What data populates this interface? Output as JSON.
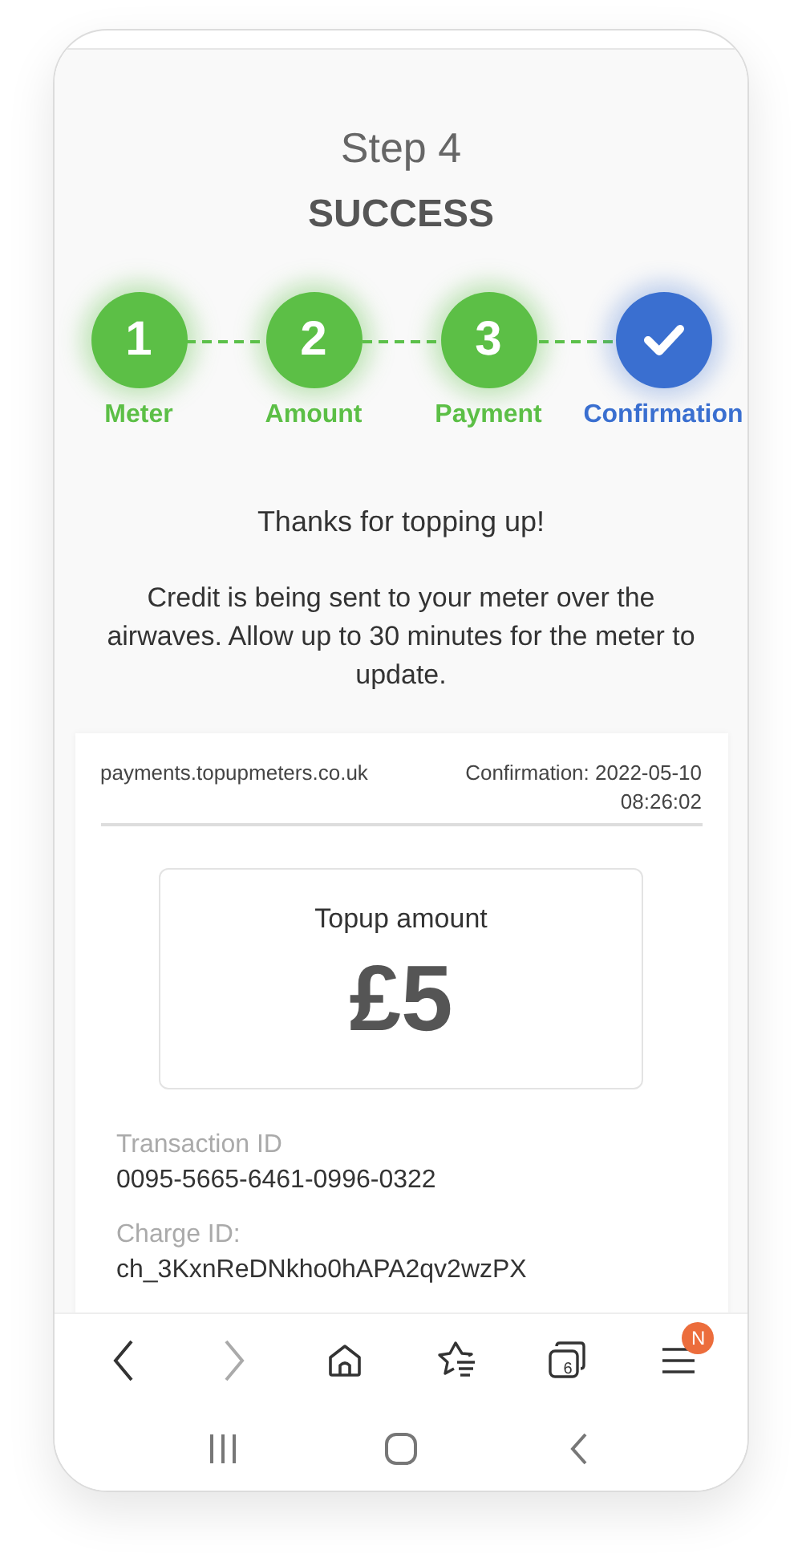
{
  "header": {
    "step": "Step 4",
    "title": "SUCCESS"
  },
  "steps": [
    {
      "kind": "number",
      "number": "1",
      "label": "Meter",
      "current": false
    },
    {
      "kind": "number",
      "number": "2",
      "label": "Amount",
      "current": false
    },
    {
      "kind": "number",
      "number": "3",
      "label": "Payment",
      "current": false
    },
    {
      "kind": "check",
      "label": "Confirmation",
      "current": true
    }
  ],
  "message": {
    "thanks": "Thanks for topping up!",
    "body": "Credit is being sent to your meter over the airwaves.  Allow up to 30 minutes for the meter to update."
  },
  "receipt": {
    "site": "payments.topupmeters.co.uk",
    "confirmation": "Confirmation: 2022-05-10 08:26:02",
    "amount_label": "Topup amount",
    "amount": "£5",
    "fields": [
      {
        "label": "Transaction ID",
        "value": "0095-5665-6461-0996-0322"
      },
      {
        "label": "Charge ID:",
        "value": "ch_3KxnReDNkho0hAPA2qv2wzPX"
      }
    ]
  },
  "browser_toolbar": {
    "back_disabled": false,
    "forward_disabled": true,
    "tab_count": "6",
    "menu_badge": "N"
  }
}
